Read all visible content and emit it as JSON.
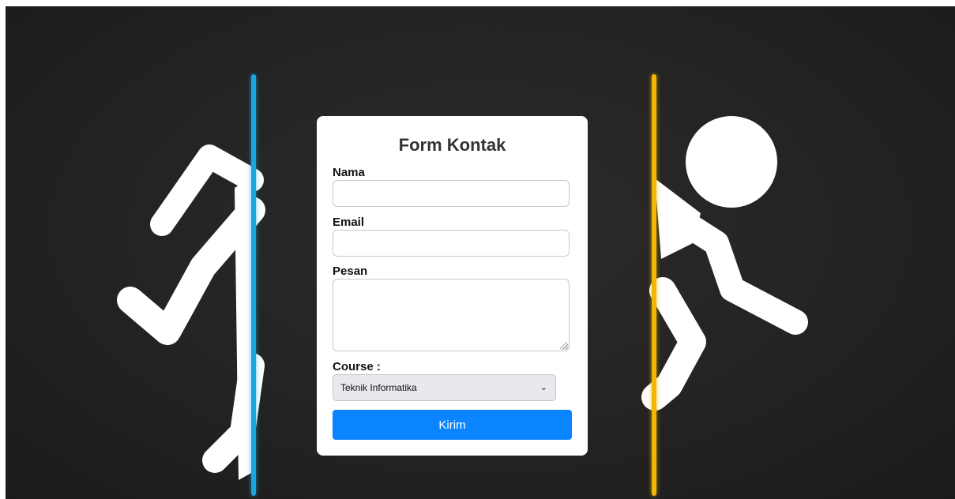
{
  "form": {
    "title": "Form Kontak",
    "name_label": "Nama",
    "name_value": "",
    "email_label": "Email",
    "email_value": "",
    "message_label": "Pesan",
    "message_value": "",
    "course_label": "Course :",
    "course_selected": "Teknik Informatika",
    "submit_label": "Kirim"
  },
  "colors": {
    "background": "#222222",
    "portal_left": "#1aa6df",
    "portal_right": "#f2b705",
    "button": "#0a84ff",
    "card": "#ffffff"
  },
  "icons": [
    "running-figure-left-illustration",
    "running-figure-right-illustration",
    "chevron-down-icon",
    "resize-grip-icon"
  ]
}
